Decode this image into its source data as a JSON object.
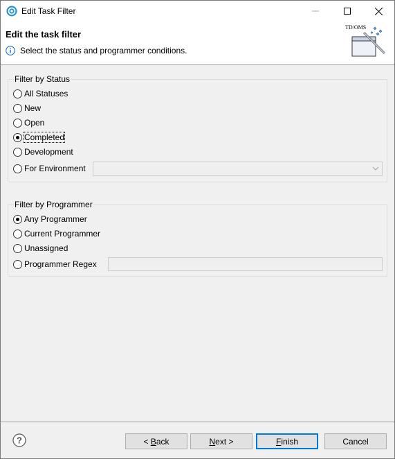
{
  "window": {
    "title": "Edit Task Filter"
  },
  "banner": {
    "title": "Edit the task filter",
    "message": "Select the status and programmer conditions.",
    "graphic_caption": "TD/OMS"
  },
  "status_group": {
    "label": "Filter by Status",
    "options": [
      {
        "label": "All Statuses",
        "checked": false
      },
      {
        "label": "New",
        "checked": false
      },
      {
        "label": "Open",
        "checked": false
      },
      {
        "label": "Completed",
        "checked": true
      },
      {
        "label": "Development",
        "checked": false
      },
      {
        "label": "For Environment",
        "checked": false
      }
    ],
    "environment_value": ""
  },
  "programmer_group": {
    "label": "Filter by Programmer",
    "options": [
      {
        "label": "Any Programmer",
        "checked": true
      },
      {
        "label": "Current Programmer",
        "checked": false
      },
      {
        "label": "Unassigned",
        "checked": false
      },
      {
        "label": "Programmer Regex",
        "checked": false
      }
    ],
    "regex_value": ""
  },
  "buttons": {
    "back_prefix": "< ",
    "back_mnemonic": "B",
    "back_rest": "ack",
    "next_prefix": "",
    "next_mnemonic": "N",
    "next_rest": "ext >",
    "finish_prefix": "",
    "finish_mnemonic": "F",
    "finish_rest": "inish",
    "cancel": "Cancel"
  },
  "colors": {
    "accent": "#0078d7",
    "app_icon": "#1f8fd6"
  }
}
